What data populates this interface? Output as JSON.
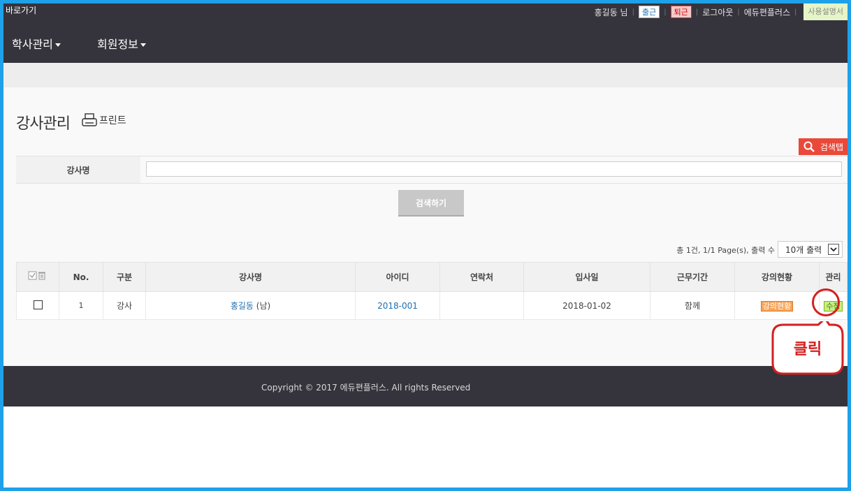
{
  "topbar": {
    "shortcut": "바로가기",
    "user": "홍길동 님",
    "checkin": "출근",
    "checkout": "퇴근",
    "logout": "로그아웃",
    "brand": "에듀편플러스",
    "manual": "사용설명서"
  },
  "nav": {
    "items": [
      {
        "label": "학사관리"
      },
      {
        "label": "회원정보"
      }
    ]
  },
  "page": {
    "title": "강사관리",
    "print": "프린트",
    "search_tab": "검색탭"
  },
  "search": {
    "label": "강사명",
    "value": "",
    "button": "검색하기"
  },
  "list": {
    "summary": "총 1건, 1/1 Page(s), 출력 수",
    "page_size": "10개 출력",
    "headers": [
      "No.",
      "구분",
      "강사명",
      "아이디",
      "연락처",
      "입사일",
      "근무기간",
      "강의현황",
      "관리"
    ],
    "rows": [
      {
        "no": "1",
        "type": "강사",
        "name": "홍길동",
        "gender": "(남)",
        "id": "2018-001",
        "phone": "",
        "join_date": "2018-01-02",
        "period": "함께",
        "lecture": "강의현황",
        "manage": "수정"
      }
    ]
  },
  "footer": {
    "copyright": "Copyright © 2017 에듀편플러스. All rights Reserved"
  },
  "annotation": {
    "text": "클릭"
  },
  "colors": {
    "dark_bar": "#35343d",
    "frame_border": "#1ea1e8",
    "search_tab": "#e9493a",
    "link": "#1d6fb0",
    "annotation": "#d51f1f"
  }
}
